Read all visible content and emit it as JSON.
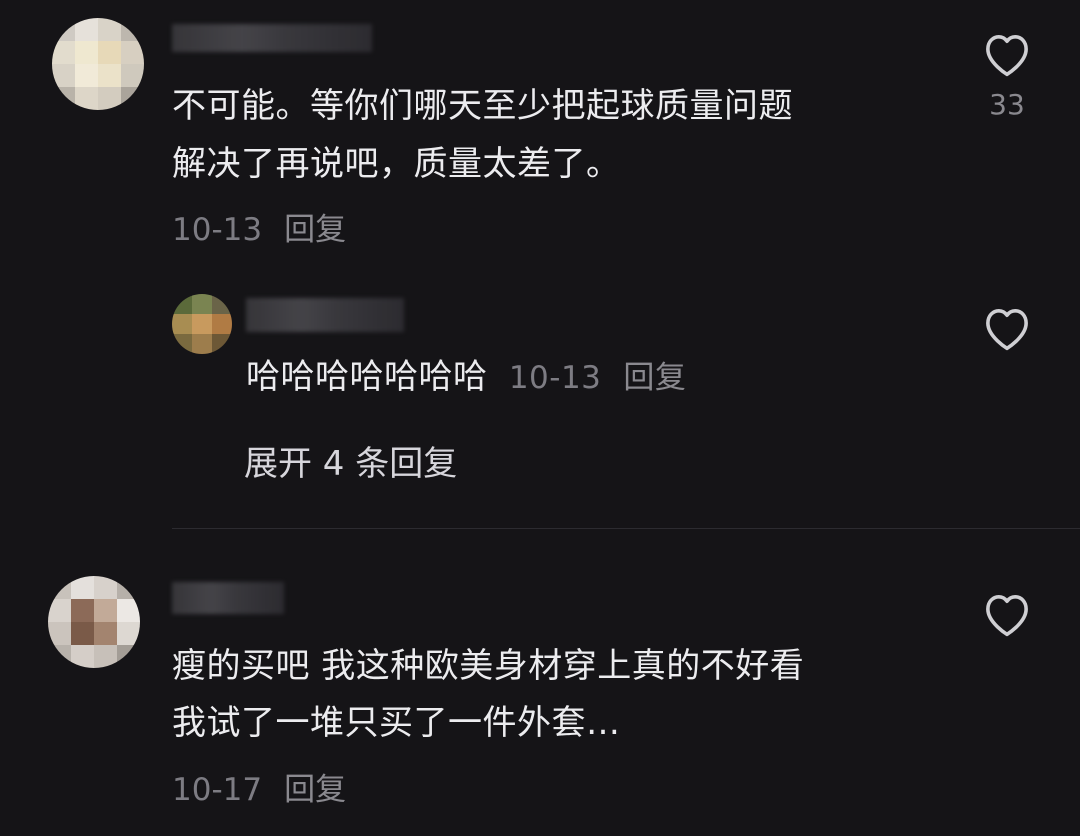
{
  "comments": [
    {
      "text_lines": [
        "不可能。等你们哪天至少把起球质量问题",
        "解决了再说吧，质量太差了。"
      ],
      "date": "10-13",
      "reply_label": "回复",
      "like_count": "33",
      "like_icon": "heart-outline-icon",
      "replies": [
        {
          "text": "哈哈哈哈哈哈哈",
          "date": "10-13",
          "reply_label": "回复",
          "like_icon": "heart-outline-icon"
        }
      ],
      "expand_label": "展开 4 条回复"
    },
    {
      "text_lines": [
        "瘦的买吧 我这种欧美身材穿上真的不好看",
        "我试了一堆只买了一件外套…"
      ],
      "date": "10-17",
      "reply_label": "回复",
      "like_icon": "heart-outline-icon"
    }
  ],
  "colors": {
    "background": "#151417",
    "text": "#ececef",
    "meta": "#7d7c83",
    "icon": "#cfcfd3"
  }
}
